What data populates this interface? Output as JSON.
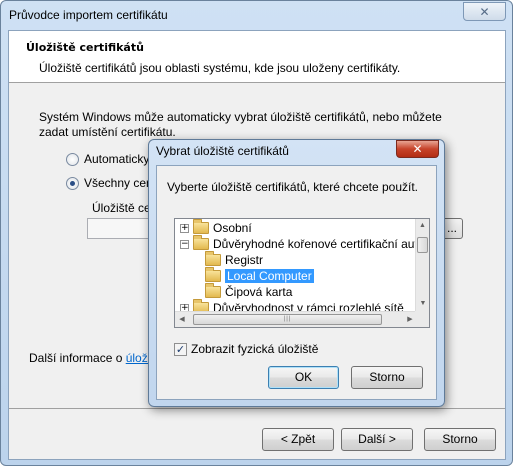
{
  "wizard": {
    "title": "Průvodce importem certifikátu",
    "close_glyph": "✕",
    "header_title": "Úložiště certifikátů",
    "header_subtitle": "Úložiště certifikátů jsou oblasti systému, kde jsou uloženy certifikáty.",
    "body_text": "Systém Windows může automaticky vybrat úložiště certifikátů, nebo můžete zadat umístění certifikátu.",
    "radio_auto_label": "Automaticky v",
    "radio_all_label": "Všechny cert",
    "store_label": "Úložiště certif",
    "store_value": "",
    "browse_label": "...",
    "more_info_prefix": "Další informace o ",
    "more_info_link": "úložiště",
    "back_label": "< Zpět",
    "next_label": "Další >",
    "cancel_label": "Storno"
  },
  "dialog": {
    "title": "Vybrat úložiště certifikátů",
    "close_glyph": "✕",
    "instruction": "Vyberte úložiště certifikátů, které chcete použít.",
    "tree": [
      {
        "label": "Osobní",
        "expander": "+",
        "level": 0,
        "selected": false
      },
      {
        "label": "Důvěryhodné kořenové certifikační autor",
        "expander": "−",
        "level": 0,
        "selected": false
      },
      {
        "label": "Registr",
        "expander": "",
        "level": 1,
        "selected": false
      },
      {
        "label": "Local Computer",
        "expander": "",
        "level": 1,
        "selected": true
      },
      {
        "label": "Čipová karta",
        "expander": "",
        "level": 1,
        "selected": false
      },
      {
        "label": "Důvěryhodnost v rámci rozlehlé sítě",
        "expander": "+",
        "level": 0,
        "selected": false
      }
    ],
    "checkbox_label": "Zobrazit fyzická úložiště",
    "checkbox_checked": true,
    "ok_label": "OK",
    "cancel_label": "Storno"
  }
}
